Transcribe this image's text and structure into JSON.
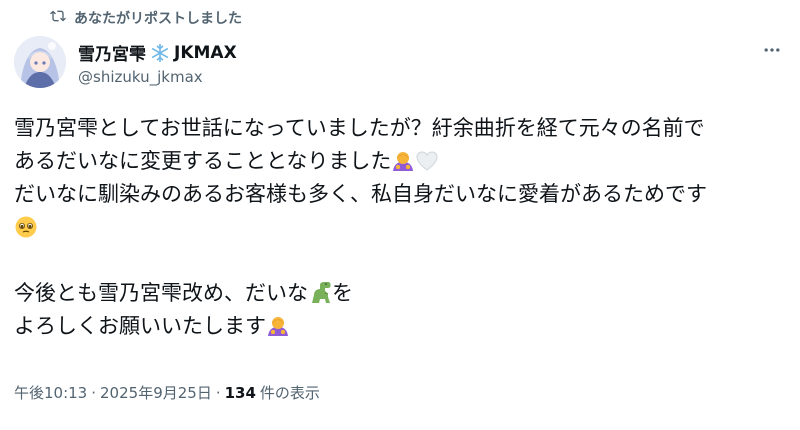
{
  "repost": {
    "label": "あなたがリポストしました",
    "icon": "repost-icon"
  },
  "author": {
    "display_name": "雪乃宮雫",
    "name_suffix": "JKMAX",
    "name_emoji": "snowflake-icon",
    "handle": "@shizuku_jkmax",
    "avatar_icon": "avatar"
  },
  "more_icon": "more-options-icon",
  "tweet": {
    "line1": "雪乃宮雫としてお世話になっていましたが？紆余曲折を経て元々の名前で",
    "line2": "あるだいなに変更することとなりました",
    "line3": "だいなに馴染みのあるお客様も多く、私自身だいなに愛着があるためです",
    "line5": "今後とも雪乃宮雫改め、だいな",
    "line5_tail": "を",
    "line6": "よろしくお願いいたします"
  },
  "emojis": {
    "bow": "person-bowing-emoji",
    "white_heart": "white-heart-emoji",
    "pleading": "pleading-face-emoji",
    "dino": "t-rex-emoji"
  },
  "meta": {
    "time": "午後10:13",
    "sep1": "·",
    "date": "2025年9月25日",
    "sep2": "·",
    "views": "134",
    "views_label": "件の表示"
  },
  "colors": {
    "text": "#0f1419",
    "secondary": "#536471",
    "background": "#ffffff"
  }
}
